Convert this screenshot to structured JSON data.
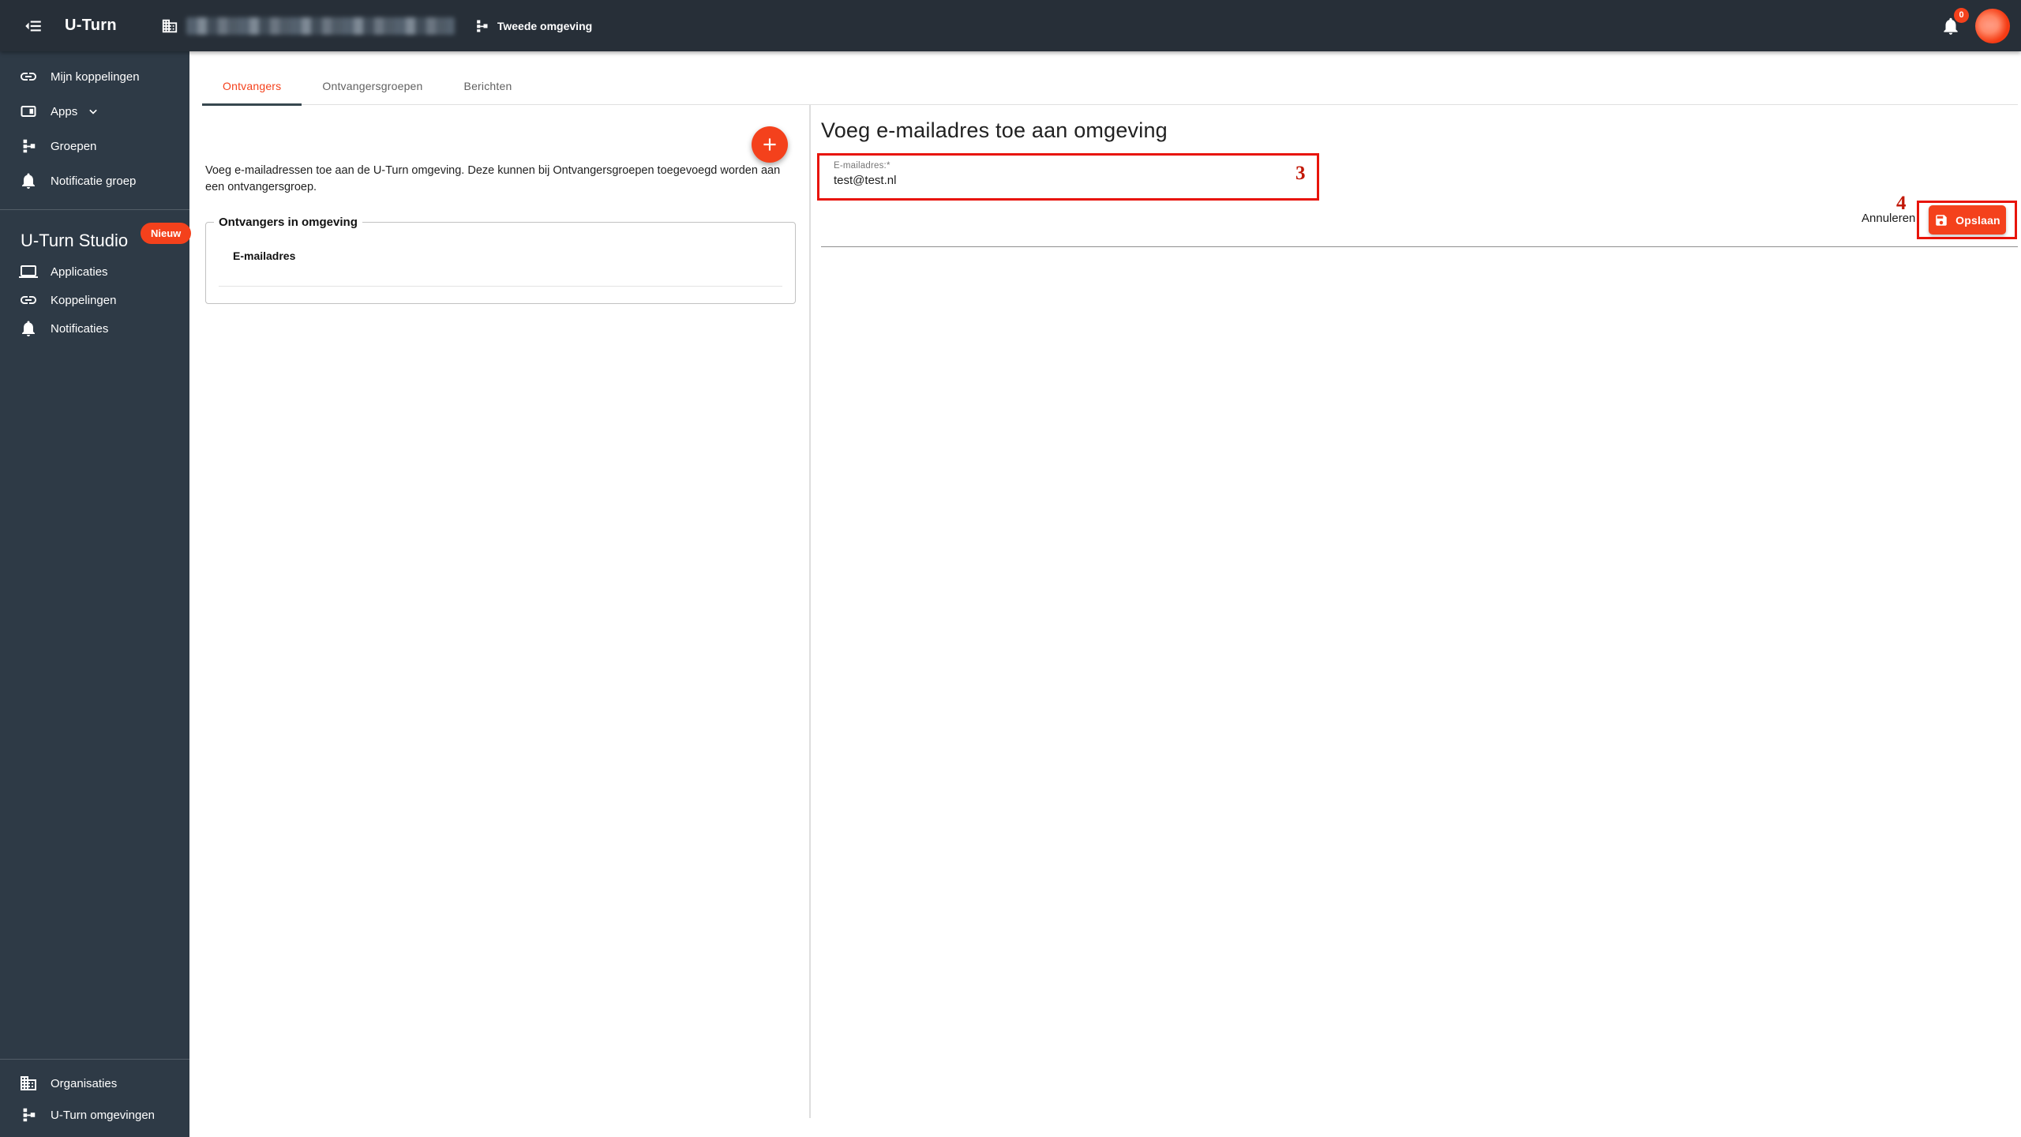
{
  "topbar": {
    "app_title": "U-Turn",
    "environment": "Tweede omgeving",
    "notification_badge": "0"
  },
  "sidebar": {
    "main_items": [
      {
        "label": "Mijn koppelingen",
        "icon": "link-icon"
      },
      {
        "label": "Apps",
        "icon": "apps-icon"
      },
      {
        "label": "Groepen",
        "icon": "hierarchy-icon"
      },
      {
        "label": "Notificatie groep",
        "icon": "bell-icon"
      }
    ],
    "studio_section": {
      "title": "U-Turn Studio",
      "badge": "Nieuw",
      "items": [
        {
          "label": "Applicaties",
          "icon": "laptop-icon"
        },
        {
          "label": "Koppelingen",
          "icon": "link-icon"
        },
        {
          "label": "Notificaties",
          "icon": "bell-icon"
        }
      ]
    },
    "bottom_items": [
      {
        "label": "Organisaties",
        "icon": "building-icon"
      },
      {
        "label": "U-Turn omgevingen",
        "icon": "hierarchy-icon"
      }
    ]
  },
  "tabs": [
    {
      "label": "Ontvangers",
      "active": true
    },
    {
      "label": "Ontvangersgroepen",
      "active": false
    },
    {
      "label": "Berichten",
      "active": false
    }
  ],
  "left_panel": {
    "intro_text": "Voeg e-mailadressen toe aan de U-Turn omgeving. Deze kunnen bij Ontvangersgroepen toegevoegd worden aan een ontvangersgroep.",
    "fieldset_legend": "Ontvangers in omgeving",
    "table_header": "E-mailadres"
  },
  "form_panel": {
    "title": "Voeg e-mailadres toe aan omgeving",
    "email_label": "E-mailadres:*",
    "email_value": "test@test.nl",
    "cancel_label": "Annuleren",
    "save_label": "Opslaan"
  },
  "annotations": [
    {
      "number": "3"
    },
    {
      "number": "4"
    }
  ],
  "colors": {
    "accent": "#F4411C",
    "topbar_bg": "#272F38",
    "sidebar_bg": "#2E3A46",
    "tab_indicator": "#37474F",
    "annotation_border": "#E8140A",
    "annotation_label": "#C21807"
  }
}
